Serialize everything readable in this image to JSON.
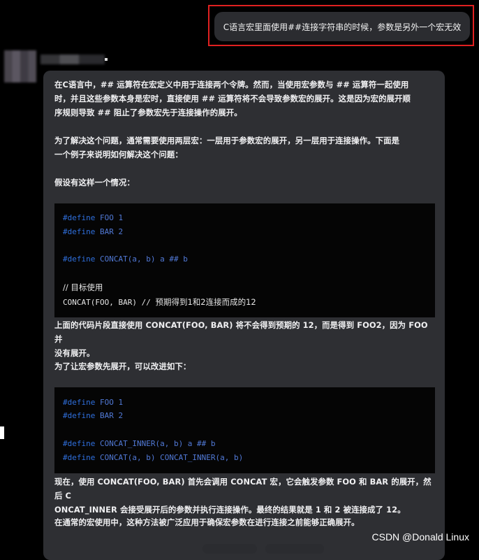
{
  "user_message": "C语言宏里面使用##连接字符串的时候，参数是另外一个宏无效",
  "answer": {
    "p1": [
      "在C语言中，## 运算符在宏定义中用于连接两个令牌。然而，当使用宏参数与 ## 运算符一起使用",
      "时，并且这些参数本身是宏时，直接使用 ## 运算符将不会导致参数宏的展开。这是因为宏的展开顺",
      "序规则导致 ## 阻止了参数宏先于连接操作的展开。"
    ],
    "p2": [
      "为了解决这个问题，通常需要使用两层宏：一层用于参数宏的展开，另一层用于连接操作。下面是",
      "一个例子来说明如何解决这个问题："
    ],
    "p3": "假设有这样一个情况：",
    "code1": {
      "l1_kw": "#define",
      "l1_rest": " FOO 1",
      "l2_kw": "#define",
      "l2_rest": " BAR 2",
      "l3_kw": "#define",
      "l3_rest": " CONCAT(a, b) a ## b",
      "l4": "// 目标使用",
      "l5_code": "CONCAT(FOO, BAR) // ",
      "l5_comment": "预期得到1和2连接而成的12"
    },
    "p4": [
      "上面的代码片段直接使用 CONCAT(FOO, BAR) 将不会得到预期的 12，而是得到 FOO2，因为 FOO 并",
      "没有展开。"
    ],
    "p5": "为了让宏参数先展开，可以改进如下：",
    "code2": {
      "l1_kw": "#define",
      "l1_rest": " FOO 1",
      "l2_kw": "#define",
      "l2_rest": " BAR 2",
      "l3_kw": "#define",
      "l3_rest": " CONCAT_INNER(a, b) a ## b",
      "l4_kw": "#define",
      "l4_rest": " CONCAT(a, b) CONCAT_INNER(a, b)"
    },
    "p6": [
      "现在，使用 CONCAT(FOO, BAR) 首先会调用 CONCAT 宏，它会触发参数 FOO 和 BAR 的展开，然后 C",
      "ONCAT_INNER 会接受展开后的参数并执行连接操作。最终的结果就是 1 和 2 被连接成了 12。"
    ],
    "p7": "在通常的宏使用中，这种方法被广泛应用于确保宏参数在进行连接之前能够正确展开。"
  },
  "watermark": "CSDN @Donald Linux",
  "colors": {
    "highlight": "#e02020",
    "keyword": "#2f6fdc",
    "card": "#2e2f33"
  }
}
